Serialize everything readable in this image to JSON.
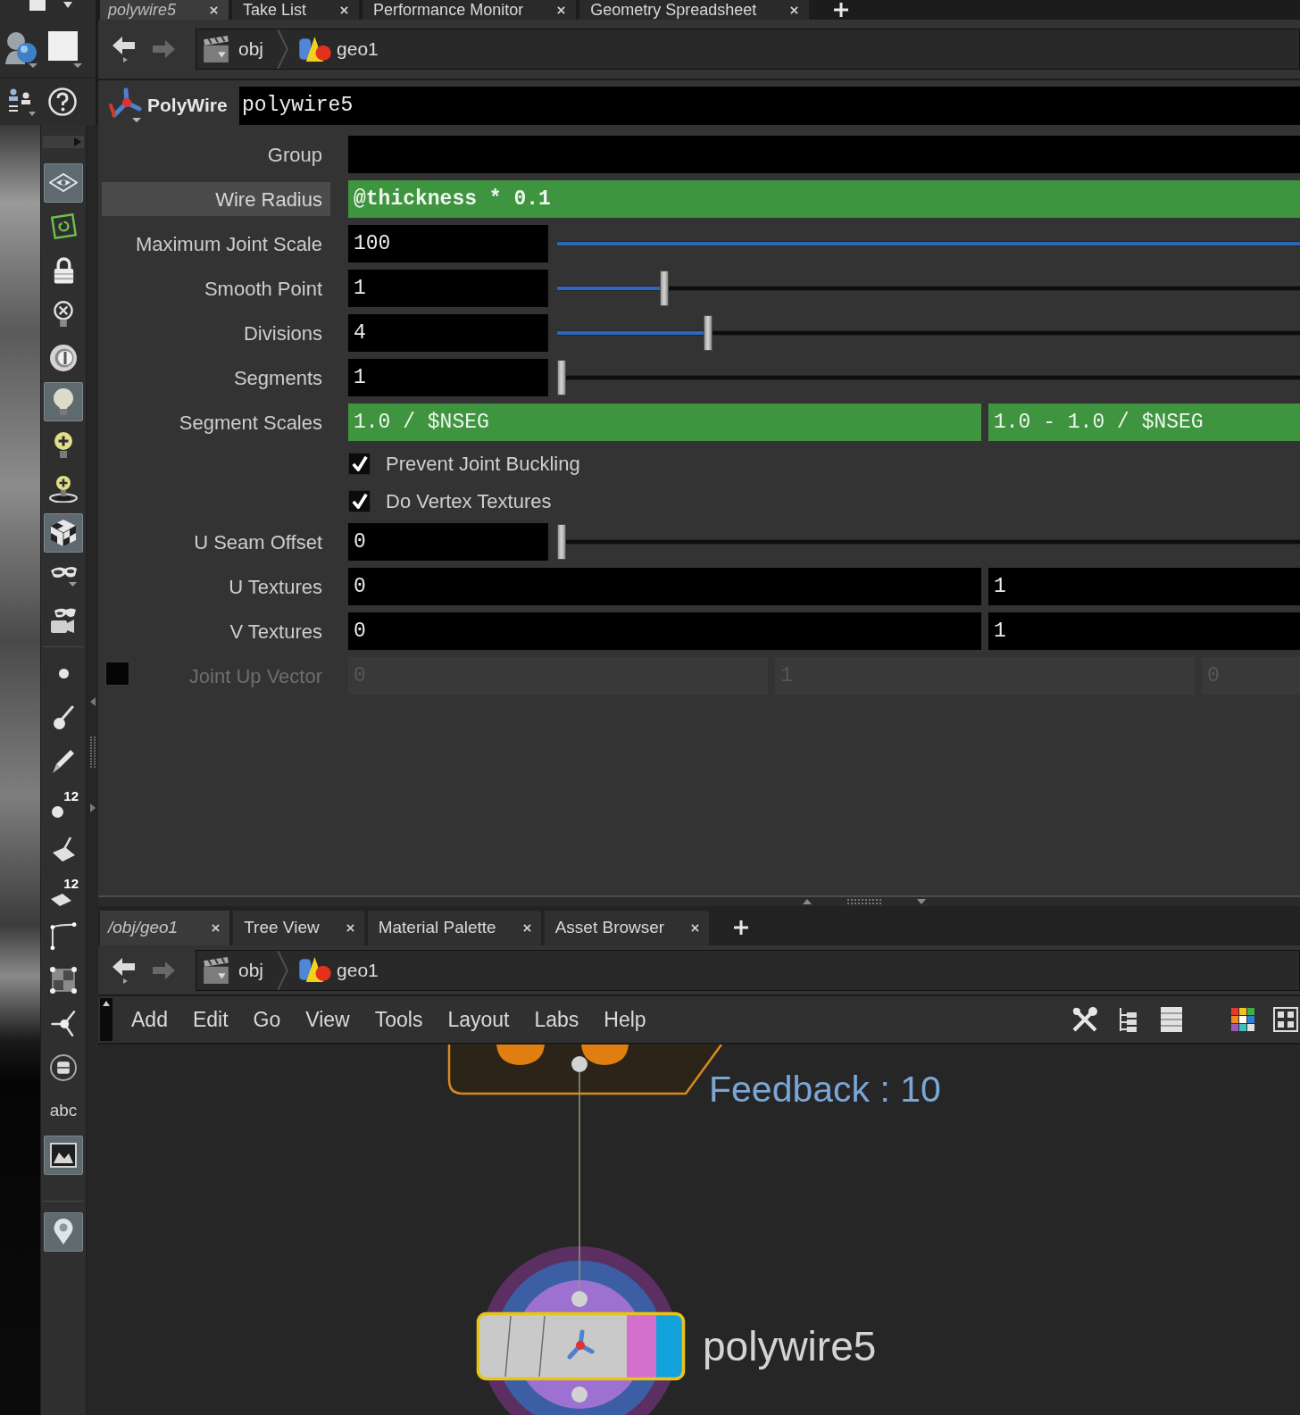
{
  "pane_tabs": [
    {
      "label": "polywire5",
      "selected": true
    },
    {
      "label": "Take List",
      "selected": false
    },
    {
      "label": "Performance Monitor",
      "selected": false
    },
    {
      "label": "Geometry Spreadsheet",
      "selected": false
    }
  ],
  "path": [
    {
      "kind": "obj",
      "label": "obj"
    },
    {
      "kind": "geo",
      "label": "geo1"
    }
  ],
  "node_header": {
    "type": "PolyWire",
    "name": "polywire5"
  },
  "parameters": [
    {
      "kind": "text",
      "label": "Group",
      "highlighted": false,
      "disabled": false
    },
    {
      "kind": "expression",
      "label": "Wire Radius",
      "highlighted": true,
      "disabled": false,
      "values": [
        "@thickness * 0.1"
      ]
    },
    {
      "kind": "slider",
      "label": "Maximum Joint Scale",
      "highlighted": false,
      "disabled": false,
      "value": "100",
      "level": 1
    },
    {
      "kind": "slider",
      "label": "Smooth Point",
      "highlighted": false,
      "disabled": false,
      "value": "1",
      "level": 0.14
    },
    {
      "kind": "slider",
      "label": "Divisions",
      "highlighted": false,
      "disabled": false,
      "value": "4",
      "level": 0.2
    },
    {
      "kind": "slider",
      "label": "Segments",
      "highlighted": false,
      "disabled": false,
      "value": "1",
      "level": 0
    },
    {
      "kind": "expression",
      "label": "Segment Scales",
      "highlighted": false,
      "disabled": false,
      "values": [
        "1.0 / $NSEG",
        "1.0 - 1.0 / $NSEG"
      ]
    },
    {
      "kind": "checkbox",
      "label": "Prevent Joint Buckling",
      "highlighted": false,
      "disabled": false,
      "checked": true
    },
    {
      "kind": "checkbox",
      "label": "Do Vertex Textures",
      "highlighted": false,
      "disabled": false,
      "checked": true
    },
    {
      "kind": "slider",
      "label": "U Seam Offset",
      "highlighted": false,
      "disabled": false,
      "value": "0",
      "level": 0
    },
    {
      "kind": "vector",
      "label": "U Textures",
      "highlighted": false,
      "disabled": false,
      "values": [
        "0",
        "1"
      ]
    },
    {
      "kind": "vector",
      "label": "V Textures",
      "highlighted": false,
      "disabled": false,
      "values": [
        "0",
        "1"
      ]
    },
    {
      "kind": "vector",
      "label": "Joint Up Vector",
      "highlighted": false,
      "disabled": true,
      "toggle": false,
      "values": [
        "0",
        "1",
        "0"
      ]
    }
  ],
  "network_tabs": [
    {
      "label": "/obj/geo1",
      "selected": true
    },
    {
      "label": "Tree View",
      "selected": false
    },
    {
      "label": "Material Palette",
      "selected": false
    },
    {
      "label": "Asset Browser",
      "selected": false
    }
  ],
  "network_path": [
    {
      "kind": "obj",
      "label": "obj"
    },
    {
      "kind": "geo",
      "label": "geo1"
    }
  ],
  "menu": [
    "Add",
    "Edit",
    "Go",
    "View",
    "Tools",
    "Layout",
    "Labs",
    "Help"
  ],
  "network": {
    "annotation": "Feedback : 10",
    "nodes": [
      {
        "kind": "cropped",
        "selected": false
      },
      {
        "kind": "polywire",
        "label": "polywire5",
        "selected": true
      }
    ]
  },
  "shelf": {
    "groups": [
      [
        {
          "kind": "icon",
          "on": true
        },
        {
          "kind": "icon",
          "on": false
        },
        {
          "kind": "icon",
          "on": false
        },
        {
          "kind": "icon",
          "on": false
        },
        {
          "kind": "icon",
          "on": false
        },
        {
          "kind": "icon",
          "on": true
        },
        {
          "kind": "icon",
          "on": false
        },
        {
          "kind": "icon",
          "on": false
        },
        {
          "kind": "icon",
          "on": true
        },
        {
          "kind": "icon",
          "on": false
        },
        {
          "kind": "icon",
          "on": false
        }
      ],
      [
        {
          "kind": "icon",
          "on": false
        },
        {
          "kind": "icon",
          "on": false
        },
        {
          "kind": "icon",
          "on": false
        },
        {
          "kind": "numbered",
          "label": "12",
          "on": false
        },
        {
          "kind": "icon",
          "on": false
        },
        {
          "kind": "numbered",
          "label": "12",
          "on": false
        },
        {
          "kind": "icon",
          "on": false
        },
        {
          "kind": "icon",
          "on": false
        },
        {
          "kind": "icon",
          "on": false
        },
        {
          "kind": "icon",
          "on": false
        },
        {
          "kind": "text",
          "label": "abc",
          "on": false
        },
        {
          "kind": "icon",
          "on": true
        }
      ],
      [
        {
          "kind": "icon",
          "on": true
        }
      ]
    ]
  }
}
